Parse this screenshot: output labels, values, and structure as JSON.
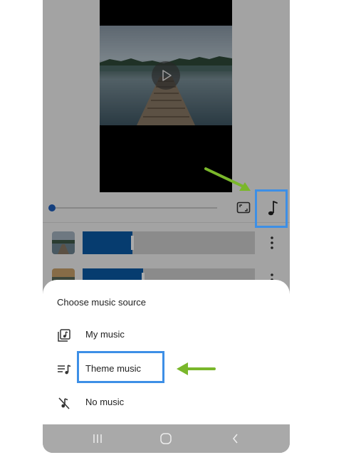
{
  "sheet": {
    "title": "Choose music source",
    "options": [
      {
        "label": "My music",
        "icon": "music-library-icon"
      },
      {
        "label": "Theme music",
        "icon": "playlist-icon"
      },
      {
        "label": "No music",
        "icon": "music-off-icon"
      }
    ]
  },
  "editor": {
    "seek_progress": 0,
    "clips": [
      {
        "fill_fraction": 0.29
      },
      {
        "fill_fraction": 0.35
      }
    ]
  },
  "navigation": {
    "recents_icon": "recents-icon",
    "home_icon": "home-icon",
    "back_icon": "back-icon"
  },
  "colors": {
    "accent": "#1f5fbd",
    "clip_fill": "#0a5aa6",
    "highlight": "#3d8fe6",
    "annotation_arrow": "#7ab72b"
  }
}
